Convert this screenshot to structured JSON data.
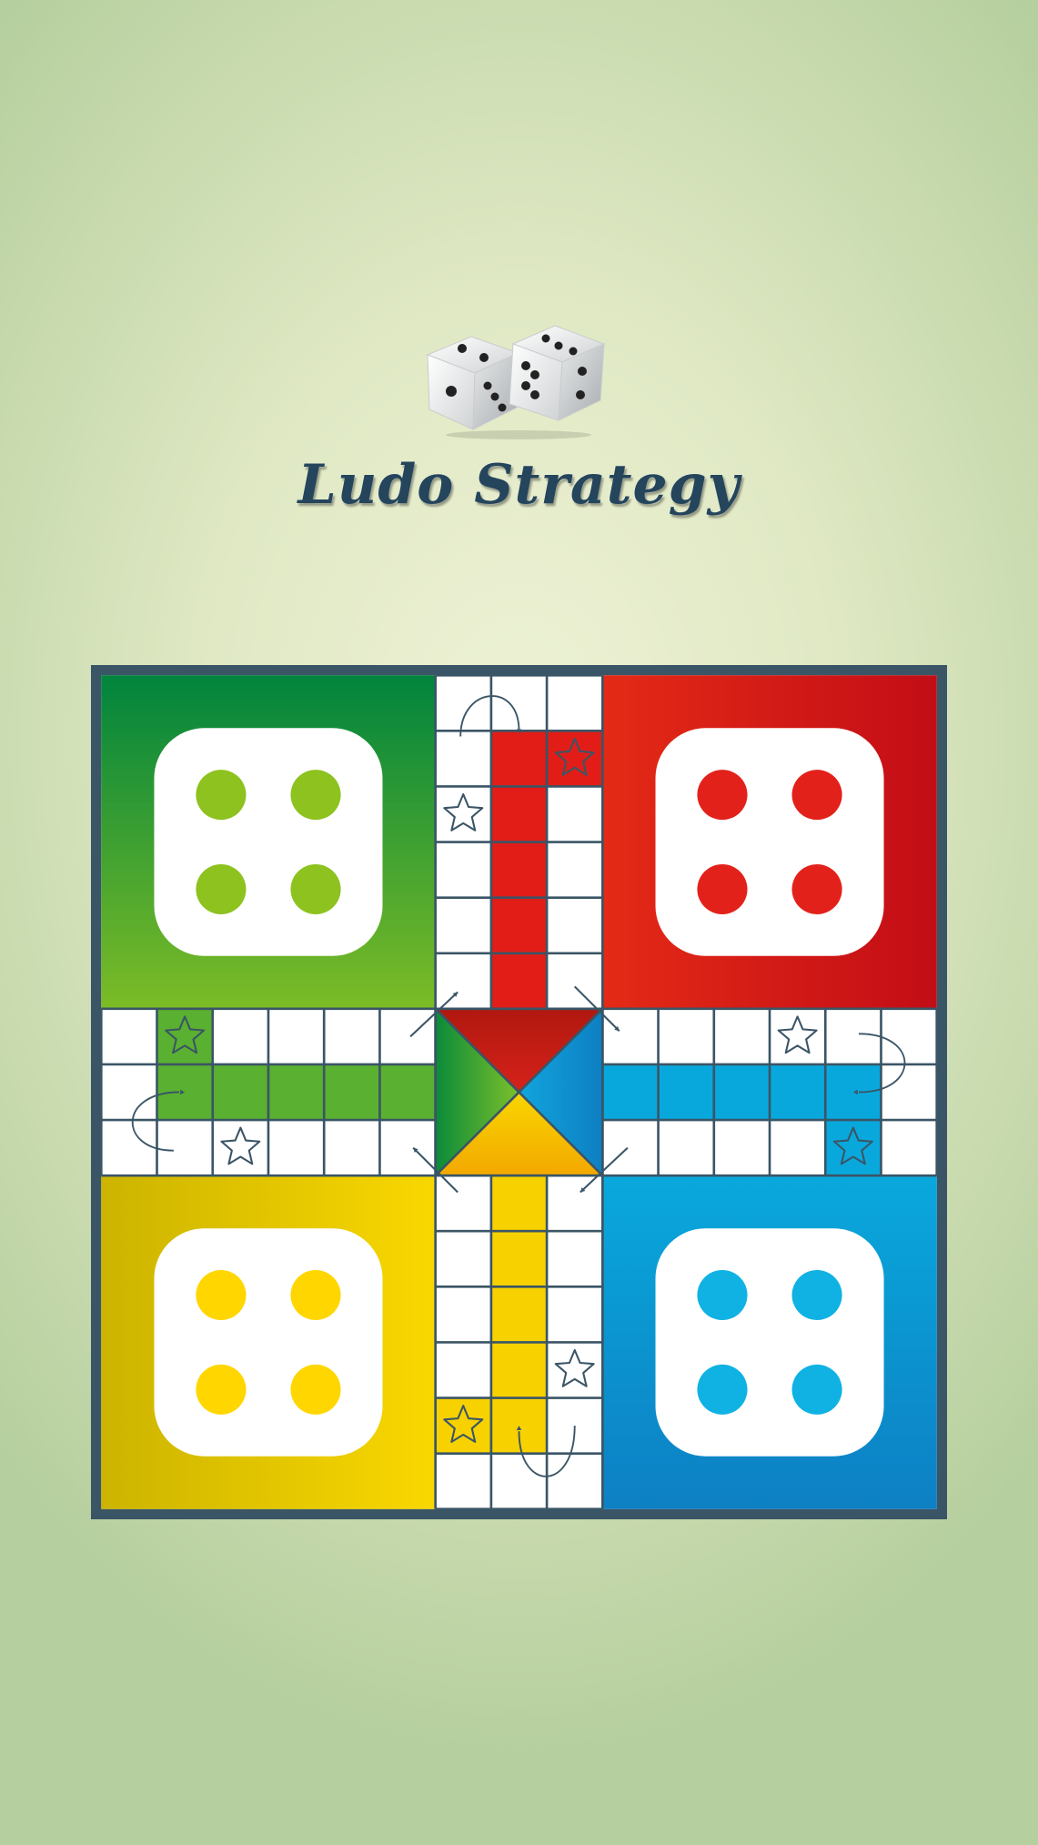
{
  "app": {
    "title": "Ludo Strategy",
    "logo_icon": "two-dice-icon"
  },
  "board": {
    "players": [
      {
        "id": "green",
        "position": "top-left",
        "color": "#5ab030",
        "color_dark": "#00843d",
        "pip_color": "#8dc21f",
        "home_pips": 4
      },
      {
        "id": "red",
        "position": "top-right",
        "color": "#e21d17",
        "color_dark": "#c20d16",
        "pip_color": "#e3211b",
        "home_pips": 4
      },
      {
        "id": "yellow",
        "position": "bottom-left",
        "color": "#f7d100",
        "color_dark": "#ccb400",
        "pip_color": "#ffd600",
        "home_pips": 4
      },
      {
        "id": "blue",
        "position": "bottom-right",
        "color": "#09a8dc",
        "color_dark": "#0d7fc2",
        "pip_color": "#0fb2e3",
        "home_pips": 4
      }
    ],
    "frame_color": "#3a5566",
    "safe_square_icon": "star-icon",
    "entry_arrow_icon": "curved-arrow-icon",
    "center_arrow_icon": "diagonal-arrow-icon"
  }
}
